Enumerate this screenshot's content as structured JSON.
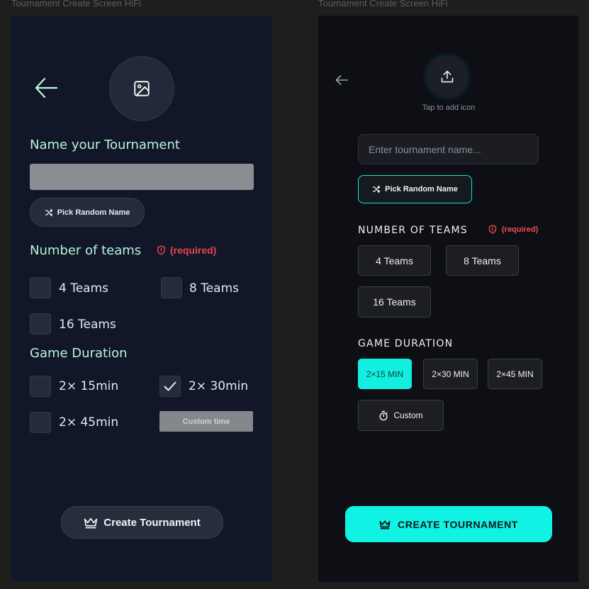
{
  "frames": {
    "left_title": "Tournament Create Screen HiFi",
    "right_title": "Tournament Create Screen HiFi"
  },
  "left": {
    "icon_placeholder": "image-icon",
    "name_heading": "Name your Tournament",
    "name_input_value": "",
    "pick_random_label": "Pick Random Name",
    "teams_heading": "Number of teams",
    "required_label": "(required)",
    "teams": [
      {
        "label": "4 Teams",
        "checked": false
      },
      {
        "label": "8 Teams",
        "checked": false
      },
      {
        "label": "16 Teams",
        "checked": false
      }
    ],
    "duration_heading": "Game Duration",
    "durations": [
      {
        "label": "2× 15min",
        "checked": false
      },
      {
        "label": "2× 30min",
        "checked": true
      },
      {
        "label": "2× 45min",
        "checked": false
      }
    ],
    "custom_time_label": "Custom time",
    "create_label": "Create Tournament"
  },
  "right": {
    "tap_label": "Tap to add icon",
    "name_placeholder": "Enter tournament name...",
    "pick_random_label": "Pick Random Name",
    "teams_heading": "NUMBER OF TEAMS",
    "required_label": "(required)",
    "teams": [
      "4 Teams",
      "8 Teams",
      "16 Teams"
    ],
    "duration_heading": "GAME DURATION",
    "durations": [
      {
        "label": "2×15 MIN",
        "selected": true
      },
      {
        "label": "2×30 MIN",
        "selected": false
      },
      {
        "label": "2×45 MIN",
        "selected": false
      }
    ],
    "custom_label": "Custom",
    "create_label": "CREATE TOURNAMENT"
  },
  "colors": {
    "left_bg": "#111729",
    "left_accent": "#b7f4d9",
    "right_bg": "#0d0f15",
    "right_accent": "#12efe0",
    "required": "#e64649"
  }
}
